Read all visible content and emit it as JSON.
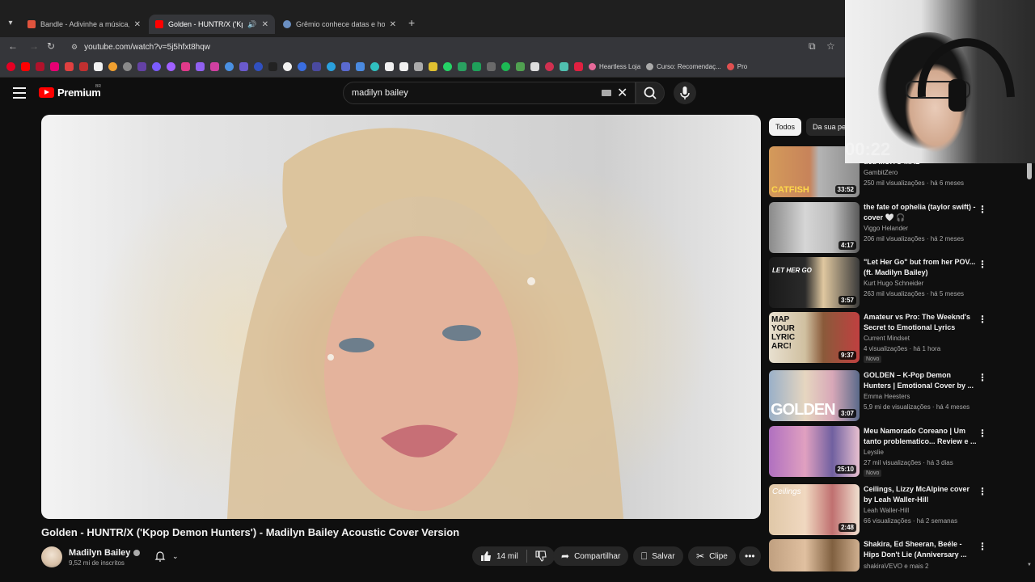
{
  "browser": {
    "tabs": [
      {
        "title": "Bandle - Adivinhe a música, um",
        "active": false
      },
      {
        "title": "Golden - HUNTR/X ('Kpop D",
        "active": true,
        "audio": true
      },
      {
        "title": "Grêmio conhece datas e horári",
        "active": false
      }
    ],
    "url": "youtube.com/watch?v=5j5hfxt8hqw",
    "bookmarks": [
      "Heartless Loja",
      "Curso: Recomendaç...",
      "Pro"
    ]
  },
  "youtube": {
    "brand": "Premium",
    "region": "BR",
    "search_value": "madilyn bailey",
    "video": {
      "title": "Golden - HUNTR/X ('Kpop Demon Hunters') - Madilyn Bailey Acoustic Cover Version",
      "channel": "Madilyn Bailey",
      "subscribers": "9,52 mi de inscritos",
      "likes": "14 mil",
      "share_label": "Compartilhar",
      "save_label": "Salvar",
      "clip_label": "Clipe"
    },
    "chips": [
      "Todos",
      "Da sua pe"
    ],
    "recommendations": [
      {
        "title": "deu MUITO MAL",
        "channel": "GambitZero",
        "meta": "250 mil visualizações · há 6 meses",
        "duration": "33:52",
        "thumb_text": "CATFISH"
      },
      {
        "title": "the fate of ophelia (taylor swift) - cover 🤍 🎧",
        "channel": "Viggo Helander",
        "meta": "206 mil visualizações · há 2 meses",
        "duration": "4:17"
      },
      {
        "title": "\"Let Her Go\" but from her POV... (ft. Madilyn Bailey)",
        "channel": "Kurt Hugo Schneider",
        "meta": "263 mil visualizações · há 5 meses",
        "duration": "3:57",
        "thumb_text": "LET HER GO"
      },
      {
        "title": "Amateur vs Pro: The Weeknd's Secret to Emotional Lyrics",
        "channel": "Current Mindset",
        "meta": "4 visualizações · há 1 hora",
        "duration": "9:37",
        "badge": "Novo",
        "thumb_text": "MAP YOUR LYRIC ARC!"
      },
      {
        "title": "GOLDEN – K-Pop Demon Hunters | Emotional Cover by ...",
        "channel": "Emma Heesters",
        "meta": "5,9 mi de visualizações · há 4 meses",
        "duration": "3:07",
        "thumb_text": "GOLDEN"
      },
      {
        "title": "Meu Namorado Coreano | Um tanto problematico... Review e ...",
        "channel": "Leyslie",
        "meta": "27 mil visualizações · há 3 dias",
        "duration": "25:10",
        "badge": "Novo"
      },
      {
        "title": "Ceilings, Lizzy McAlpine cover by Leah Waller-Hill",
        "channel": "Leah Waller-Hill",
        "meta": "66 visualizações · há 2 semanas",
        "duration": "2:48",
        "thumb_text": "Ceilings"
      },
      {
        "title": "Shakira, Ed Sheeran, Beéle - Hips Don't Lie (Anniversary ...",
        "channel": "shakiraVEVO",
        "meta": "e mais 2",
        "duration": ""
      }
    ]
  },
  "webcam": {
    "timer": "00:22"
  },
  "colors": {
    "accent": "#ff0000",
    "bg": "#0f0f0f",
    "chip": "#272727"
  }
}
